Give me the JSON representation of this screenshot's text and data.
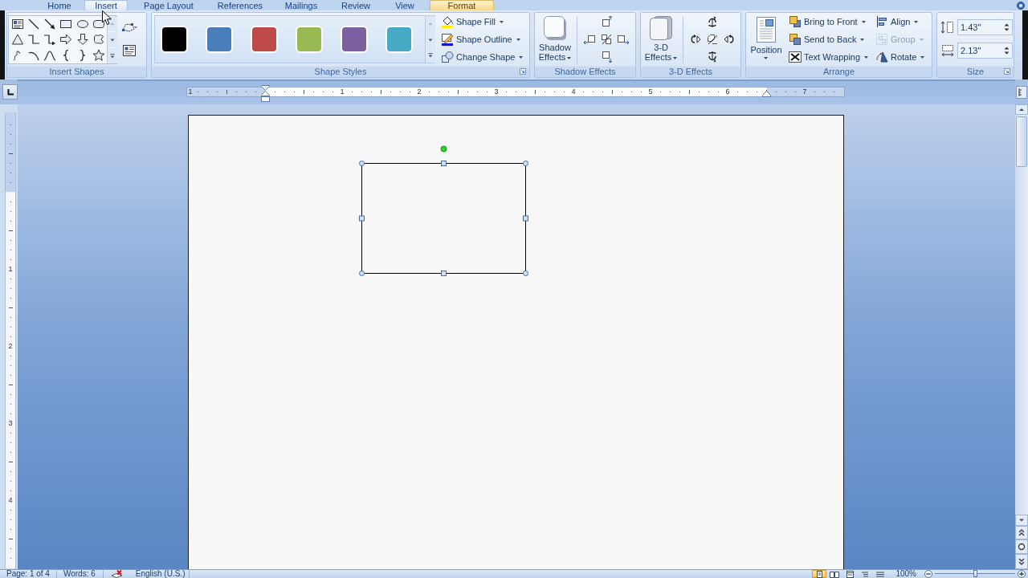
{
  "tabs": [
    {
      "label": "Home",
      "selected": false,
      "hovered": false
    },
    {
      "label": "Insert",
      "selected": false,
      "hovered": true
    },
    {
      "label": "Page Layout",
      "selected": false,
      "hovered": false
    },
    {
      "label": "References",
      "selected": false,
      "hovered": false
    },
    {
      "label": "Mailings",
      "selected": false,
      "hovered": false
    },
    {
      "label": "Review",
      "selected": false,
      "hovered": false
    },
    {
      "label": "View",
      "selected": false,
      "hovered": false
    },
    {
      "label": "Format",
      "selected": true,
      "hovered": false
    }
  ],
  "insert_shapes": {
    "label": "Insert Shapes"
  },
  "shape_styles": {
    "label": "Shape Styles",
    "swatches": [
      {
        "color": "#000000"
      },
      {
        "color": "#4a7ebb"
      },
      {
        "color": "#be4b48"
      },
      {
        "color": "#98b954"
      },
      {
        "color": "#7d60a0"
      },
      {
        "color": "#46aac5"
      }
    ],
    "commands": [
      {
        "label": "Shape Fill"
      },
      {
        "label": "Shape Outline"
      },
      {
        "label": "Change Shape"
      }
    ]
  },
  "shadow_effects": {
    "label": "Shadow Effects",
    "button": "Shadow Effects"
  },
  "three_d_effects": {
    "label": "3-D Effects",
    "button": "3-D Effects"
  },
  "arrange": {
    "label": "Arrange",
    "position": "Position",
    "commands": [
      {
        "label": "Bring to Front",
        "disabled": false
      },
      {
        "label": "Send to Back",
        "disabled": false
      },
      {
        "label": "Text Wrapping",
        "disabled": false
      },
      {
        "label": "Align",
        "disabled": false
      },
      {
        "label": "Group",
        "disabled": true
      },
      {
        "label": "Rotate",
        "disabled": false
      }
    ]
  },
  "size": {
    "label": "Size",
    "height": "1.43\"",
    "width": "2.13\""
  },
  "ruler": {
    "numbers": [
      "1",
      "1",
      "2",
      "3",
      "4",
      "5",
      "6",
      "7"
    ]
  },
  "vertical_ruler": {
    "numbers": [
      "1",
      "2",
      "3",
      "4"
    ]
  },
  "document": {
    "shape": {
      "selected": true
    }
  },
  "status_bar": {
    "page": "Page: 1 of 4",
    "words": "Words: 6",
    "language": "English (U.S.)",
    "views": [
      {
        "selected": true
      },
      {
        "selected": false
      },
      {
        "selected": false
      },
      {
        "selected": false
      },
      {
        "selected": false
      }
    ],
    "zoom": "100%",
    "zoom_slider": {
      "level": 0.5
    }
  }
}
